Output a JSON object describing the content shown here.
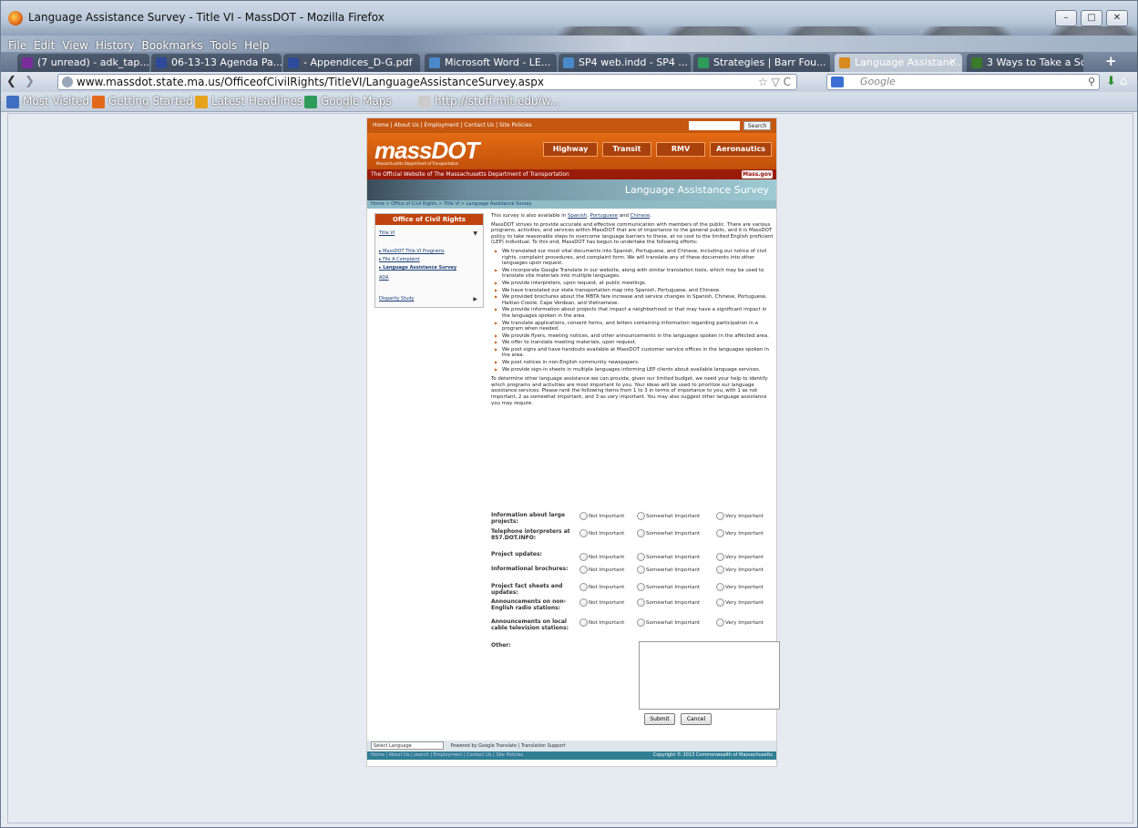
{
  "window": {
    "title": "Language Assistance Survey - Title VI - MassDOT - Mozilla Firefox"
  },
  "menu": [
    "File",
    "Edit",
    "View",
    "History",
    "Bookmarks",
    "Tools",
    "Help"
  ],
  "tabs": [
    {
      "label": "(7 unread) - adk_tap...",
      "color": "#7b2d9b"
    },
    {
      "label": "06-13-13 Agenda Pa...",
      "color": "#2d4a9b"
    },
    {
      "label": "- Appendices_D-G.pdf",
      "color": "#2d4a9b"
    },
    {
      "label": "Microsoft Word - LE...",
      "color": "#4a89c9"
    },
    {
      "label": "SP4 web.indd - SP4 ...",
      "color": "#4a89c9"
    },
    {
      "label": "Strategies | Barr Fou...",
      "color": "#2f9b5a"
    },
    {
      "label": "Language Assistanc...",
      "color": "#d98a1f"
    },
    {
      "label": "3 Ways to Take a Scr...",
      "color": "#3a7a2a"
    }
  ],
  "url": "www.massdot.state.ma.us/OfficeofCivilRights/TitleVI/LanguageAssistanceSurvey.aspx",
  "search_placeholder": "Google",
  "bookmarks": [
    "Most Visited",
    "Getting Started",
    "Latest Headlines",
    "Google Maps",
    "http://stuff.mit.edu/w..."
  ],
  "site": {
    "topnav": "Home | About Us | Employment | Contact Us | Site Policies",
    "search_button": "Search",
    "logo": "massDOT",
    "logo_sub": "Massachusetts Department of Transportation",
    "modes": [
      "Highway",
      "Transit",
      "RMV",
      "Aeronautics"
    ],
    "official": "The Official Website of The Massachusetts Department of Transportation",
    "mass_logo": "Mass.gov",
    "banner_title": "Language Assistance Survey",
    "breadcrumb": "Home > Office of Civil Rights > Title VI > Language Assistance Survey",
    "side_header": "Office of Civil Rights",
    "side_items": [
      "Title VI",
      "MassDOT Title VI Programs",
      "File A Complaint",
      "Language Assistance Survey",
      "ADA",
      "Disparity Study"
    ],
    "intro_pre": "This survey is also available in",
    "intro_langs": [
      "Spanish",
      "Portuguese",
      "Chinese"
    ],
    "intro_para": "MassDOT strives to provide accurate and effective communication with members of the public. There are various programs, activities, and services within MassDOT that are of importance to the general public, and it is MassDOT policy to take reasonable steps to overcome language barriers to these, at no cost to the limited English proficient (LEP) individual. To this end, MassDOT has begun to undertake the following efforts:",
    "efforts": [
      "We translated our most vital documents into Spanish, Portuguese, and Chinese, including our notice of civil rights, complaint procedures, and complaint form. We will translate any of these documents into other languages upon request.",
      "We incorporate Google Translate in our website, along with similar translation tools, which may be used to translate site materials into multiple languages.",
      "We provide interpreters, upon request, at public meetings.",
      "We have translated our state transportation map into Spanish, Portuguese, and Chinese.",
      "We provided brochures about the MBTA fare increase and service changes in Spanish, Chinese, Portuguese, Haitian Creole, Cape Verdean, and Vietnamese.",
      "We provide information about projects that impact a neighborhood or that may have a significant impact in the languages spoken in the area.",
      "We translate applications, consent forms, and letters containing information regarding participation in a program when needed.",
      "We provide flyers, meeting notices, and other announcements in the languages spoken in the affected area.",
      "We offer to translate meeting materials, upon request.",
      "We post signs and have handouts available at MassDOT customer service offices in the languages spoken in the area.",
      "We post notices in non-English community newspapers.",
      "We provide sign-in sheets in multiple languages informing LEP clients about available language services."
    ],
    "rank_para": "To determine other language assistance we can provide, given our limited budget, we need your help to identify which programs and activities are most important to you. Your ideas will be used to prioritize our language assistance services. Please rank the following items from 1 to 3 in terms of importance to you, with 1 as not important, 2 as somewhat important, and 3 as very important. You may also suggest other language assistance you may require.",
    "questions": [
      "Information about large projects:",
      "Telephone interpreters at 857.DOT.INFO:",
      "Project updates:",
      "Informational brochures:",
      "Project fact sheets and updates:",
      "Announcements on non-English radio stations:",
      "Announcements on local cable television stations:"
    ],
    "options": [
      "Not Important",
      "Somewhat Important",
      "Very Important"
    ],
    "other_label": "Other:",
    "submit": "Submit",
    "cancel": "Cancel",
    "select_language": "Select Language",
    "powered": "Powered by Google Translate | Translation Support",
    "footer_links": "Home | About Us | search | Employment | Contact Us | Site Policies",
    "copyright": "Copyright © 2013 Commonwealth of Massachusetts"
  }
}
